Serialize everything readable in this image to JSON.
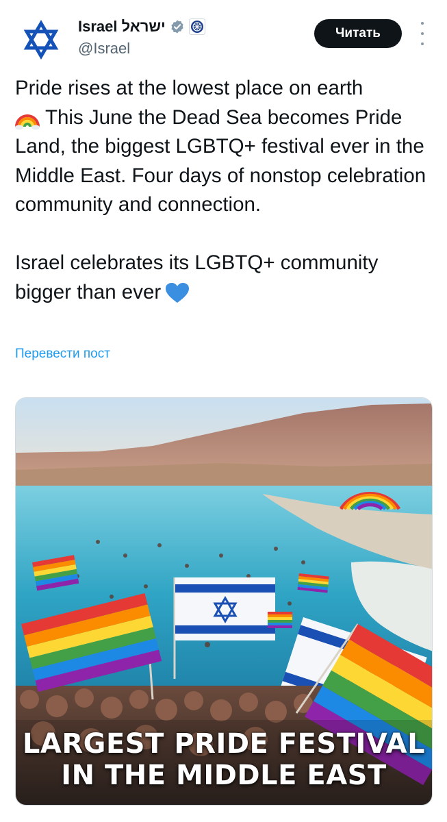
{
  "author": {
    "name": "Israel ישראל",
    "handle": "@Israel",
    "avatar_icon": "star-of-david-icon",
    "verified_icon": "verified-badge-icon",
    "affiliation_icon": "government-badge-icon"
  },
  "actions": {
    "follow_label": "Читать",
    "more_icon": "more-vertical-icon"
  },
  "tweet": {
    "line1": "Pride rises at the lowest place on earth",
    "rainbow_emoji": "rainbow",
    "line2": "This June the Dead Sea becomes Pride Land, the biggest LGBTQ+ festival ever in the Middle East. Four days of nonstop celebration community and connection.",
    "line3": "Israel celebrates its LGBTQ+ community bigger than ever",
    "heart_emoji": "blue-heart"
  },
  "translate_label": "Перевести пост",
  "media": {
    "overlay_line1": "LARGEST PRIDE FESTIVAL",
    "overlay_line2": "IN THE MIDDLE EAST"
  },
  "colors": {
    "accent": "#1d9bf0",
    "text": "#0f1419",
    "secondary": "#536471",
    "button_bg": "#0f1419"
  }
}
